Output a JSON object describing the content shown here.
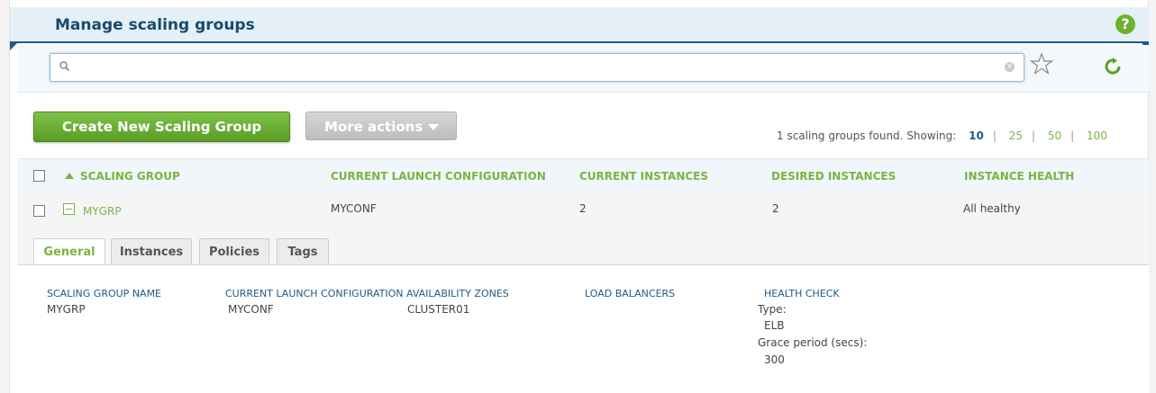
{
  "header": {
    "title": "Manage scaling groups",
    "help_icon": "help-icon"
  },
  "search": {
    "placeholder": "",
    "value": ""
  },
  "toolbar": {
    "create_label": "Create New Scaling Group",
    "more_actions_label": "More actions"
  },
  "results": {
    "found_text": "1 scaling groups found.",
    "showing_label": "Showing:",
    "page_sizes": [
      "10",
      "25",
      "50",
      "100"
    ],
    "active_page_size": "10"
  },
  "table": {
    "columns": [
      "SCALING GROUP",
      "CURRENT LAUNCH CONFIGURATION",
      "CURRENT INSTANCES",
      "DESIRED INSTANCES",
      "INSTANCE HEALTH"
    ],
    "rows": [
      {
        "name": "MYGRP",
        "launch_config": "MYCONF",
        "current_instances": "2",
        "desired_instances": "2",
        "health": "All healthy"
      }
    ]
  },
  "detail": {
    "tabs": [
      "General",
      "Instances",
      "Policies",
      "Tags"
    ],
    "active_tab": "General",
    "labels": {
      "group_name": "SCALING GROUP NAME",
      "launch_config": "CURRENT LAUNCH CONFIGURATION",
      "zones": "AVAILABILITY ZONES",
      "load_balancers": "LOAD BALANCERS",
      "health_check": "HEALTH CHECK"
    },
    "values": {
      "group_name": "MYGRP",
      "launch_config": "MYCONF",
      "zones": "CLUSTER01",
      "type_label": "Type:",
      "type_value": "ELB",
      "grace_label": "Grace period (secs):",
      "grace_value": "300"
    }
  },
  "colors": {
    "accent_green": "#7cb342",
    "brand_blue": "#1c5b86"
  }
}
